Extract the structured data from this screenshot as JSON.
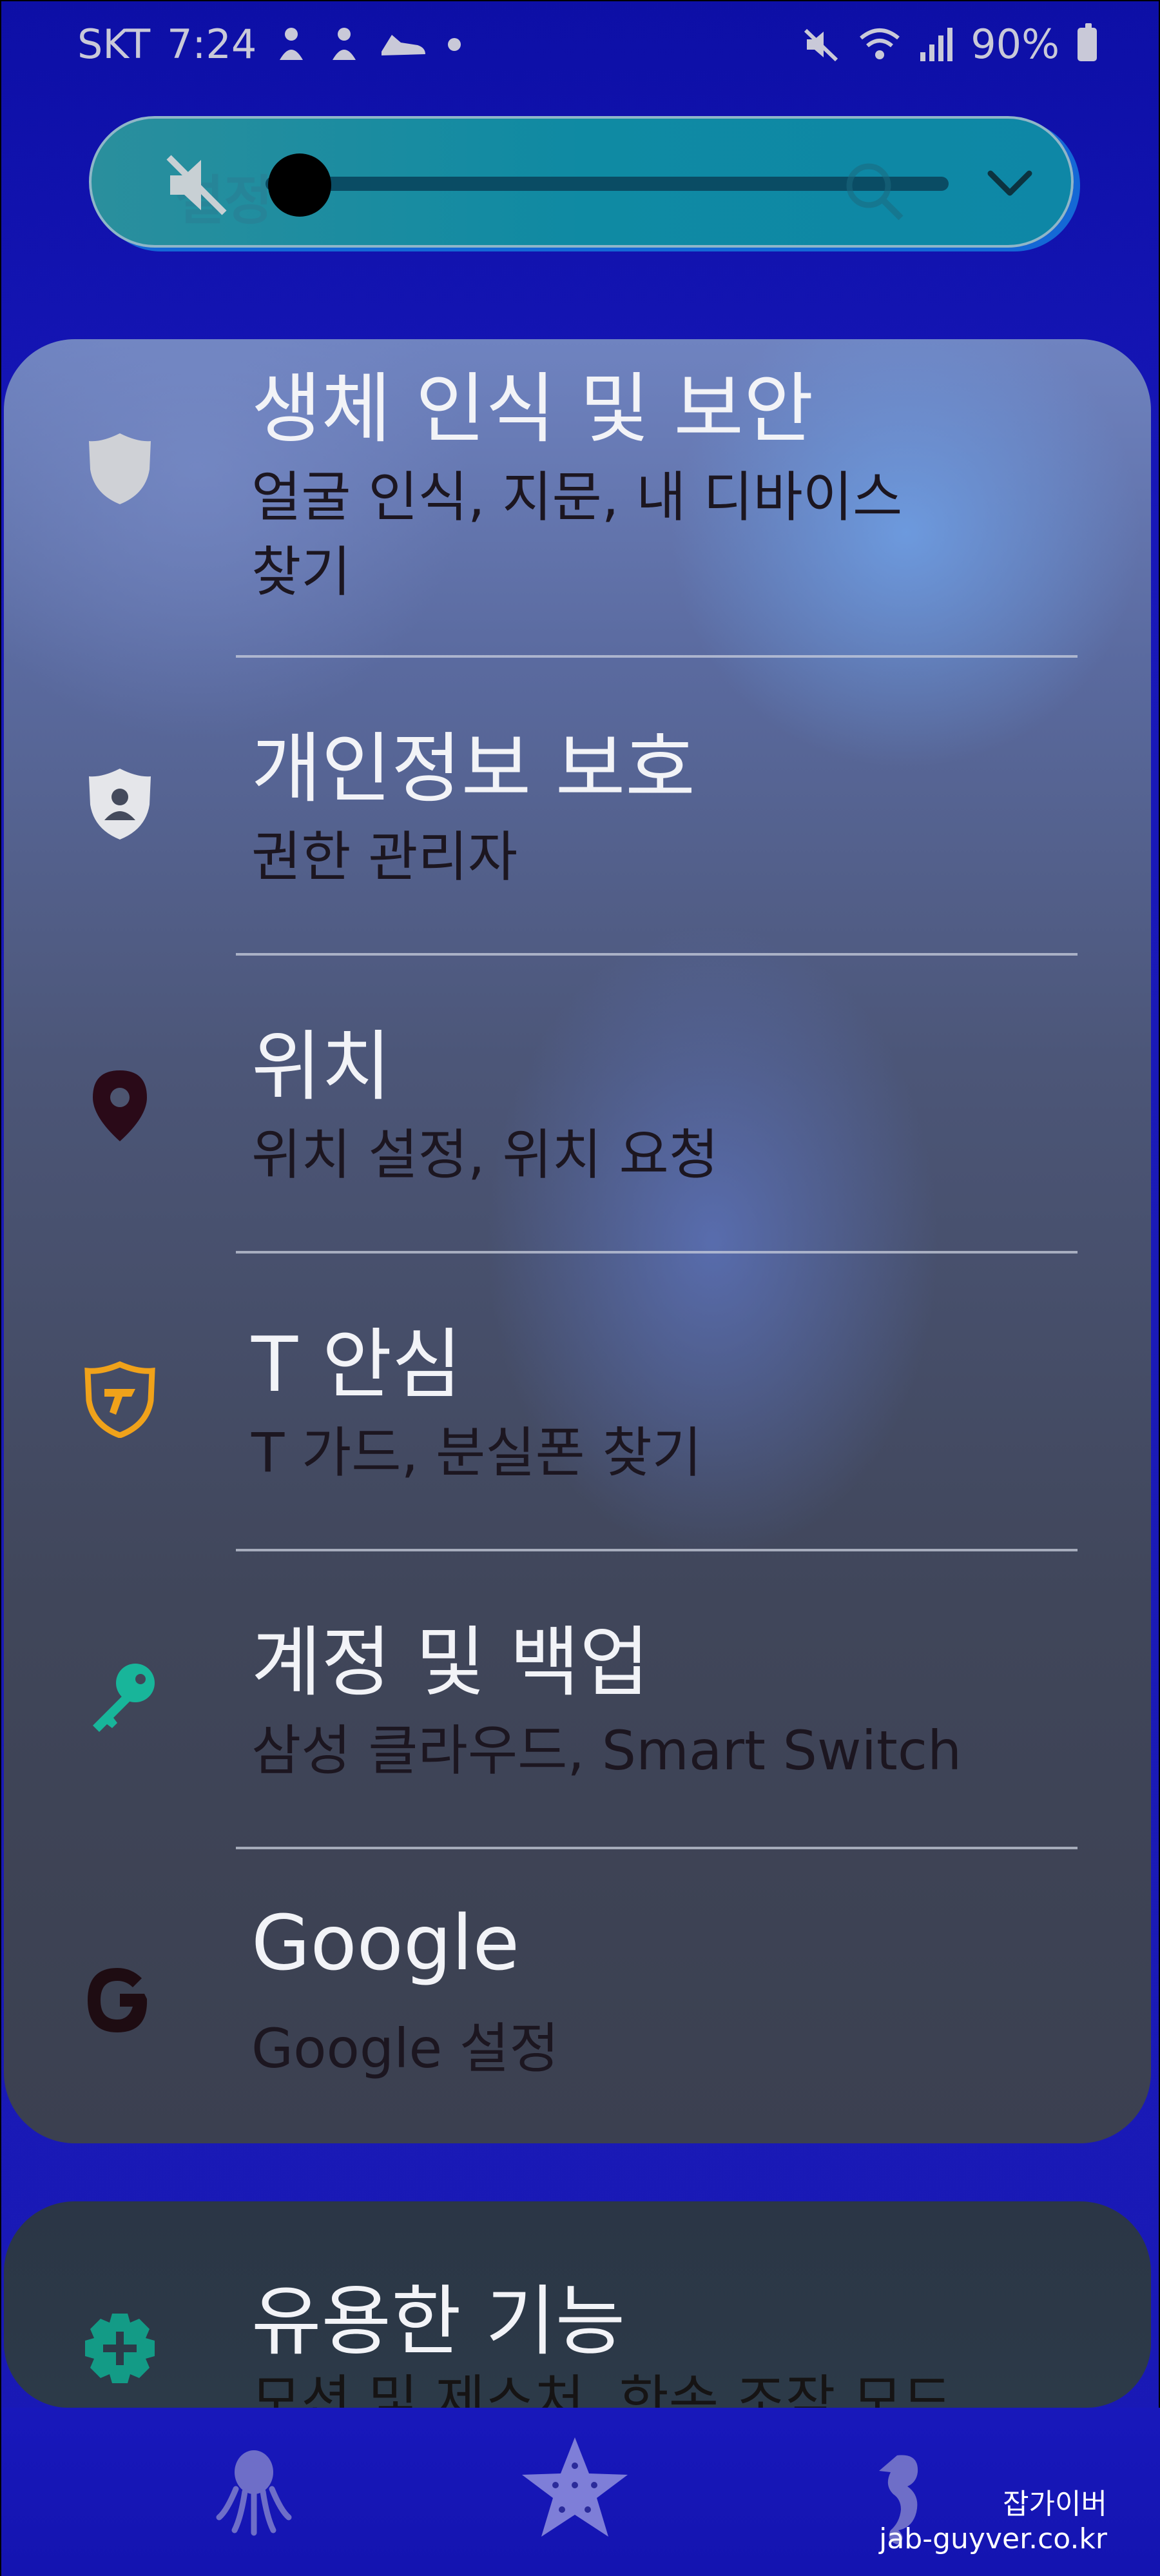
{
  "status_bar": {
    "carrier": "SKT",
    "time": "7:24",
    "battery": "90%",
    "icons_left": [
      "character-icon",
      "character-icon",
      "shoe-icon",
      "dot-icon"
    ],
    "icons_right": [
      "mute-icon",
      "wifi-icon",
      "signal-icon",
      "battery-icon"
    ]
  },
  "volume_panel": {
    "background_title": "설정",
    "level": 0,
    "icons": [
      "mute-icon",
      "search-icon",
      "chevron-down-icon"
    ]
  },
  "settings": {
    "items": [
      {
        "title": "생체 인식 및 보안",
        "subtitle": "얼굴 인식, 지문, 내 디바이스",
        "subtitle2": "찾기",
        "icon": "shield-icon",
        "icon_color": "#cfd1d6"
      },
      {
        "title": "개인정보 보호",
        "subtitle": "권한 관리자",
        "icon": "privacy-shield-icon",
        "icon_color": "#e5e6ea"
      },
      {
        "title": "위치",
        "subtitle": "위치 설정, 위치 요청",
        "icon": "location-pin-icon",
        "icon_color": "#2a0a18"
      },
      {
        "title": "T 안심",
        "subtitle": "T 가드, 분실폰 찾기",
        "icon": "t-guard-icon",
        "icon_color": "#f0a21a"
      },
      {
        "title": "계정 및 백업",
        "subtitle": "삼성 클라우드, Smart Switch",
        "icon": "key-icon",
        "icon_color": "#18b59a"
      },
      {
        "title": "Google",
        "subtitle": "Google 설정",
        "icon": "google-icon",
        "icon_color": "#1e0c12"
      }
    ],
    "partial_item": {
      "title": "유용한 기능",
      "subtitle": "모션 및 제스처, 한손 조작 모드",
      "icon": "plus-gear-icon",
      "icon_color": "#139b86"
    }
  },
  "bottom_bar": {
    "icons": [
      "octopus-icon",
      "starfish-icon",
      "seahorse-icon"
    ]
  },
  "watermark": {
    "line1": "잡가이버",
    "line2": "jab-guyver.co.kr"
  }
}
